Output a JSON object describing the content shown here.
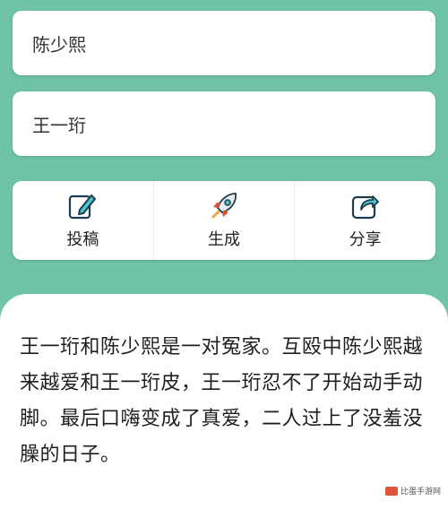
{
  "inputs": {
    "name1": {
      "value": "陈少熙"
    },
    "name2": {
      "value": "王一珩"
    }
  },
  "actions": {
    "submit": {
      "label": "投稿",
      "icon": "edit-icon"
    },
    "generate": {
      "label": "生成",
      "icon": "rocket-icon"
    },
    "share": {
      "label": "分享",
      "icon": "share-icon"
    }
  },
  "result": {
    "text": "王一珩和陈少熙是一对冤家。互殴中陈少熙越来越爱和王一珩皮，王一珩忍不了开始动手动脚。最后口嗨变成了真爱，二人过上了没羞没臊的日子。"
  },
  "watermark": {
    "text": "比蛋手游网"
  },
  "colors": {
    "background": "#6fc3a8",
    "icon_stroke": "#1d3c4c",
    "icon_accent": "#4ec3d0"
  }
}
